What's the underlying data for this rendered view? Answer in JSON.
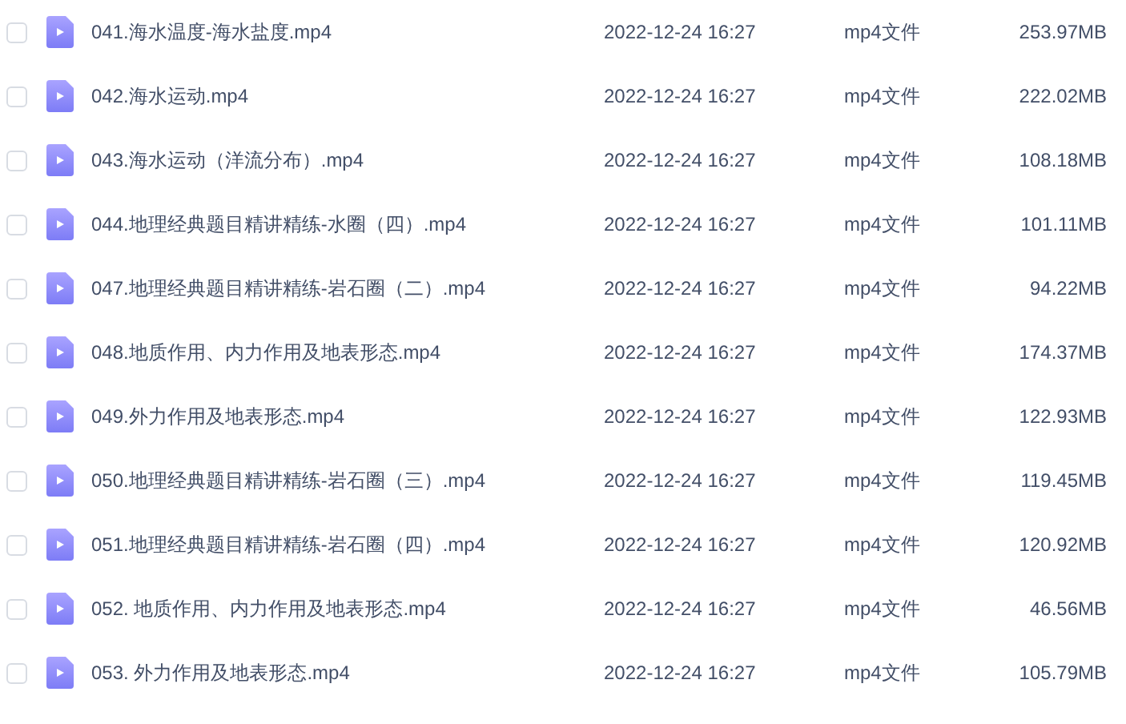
{
  "files": [
    {
      "name": "041.海水温度-海水盐度.mp4",
      "modified": "2022-12-24 16:27",
      "type": "mp4文件",
      "size": "253.97MB",
      "checked": false
    },
    {
      "name": "042.海水运动.mp4",
      "modified": "2022-12-24 16:27",
      "type": "mp4文件",
      "size": "222.02MB",
      "checked": false
    },
    {
      "name": "043.海水运动（洋流分布）.mp4",
      "modified": "2022-12-24 16:27",
      "type": "mp4文件",
      "size": "108.18MB",
      "checked": false
    },
    {
      "name": "044.地理经典题目精讲精练-水圈（四）.mp4",
      "modified": "2022-12-24 16:27",
      "type": "mp4文件",
      "size": "101.11MB",
      "checked": false
    },
    {
      "name": "047.地理经典题目精讲精练-岩石圈（二）.mp4",
      "modified": "2022-12-24 16:27",
      "type": "mp4文件",
      "size": "94.22MB",
      "checked": false
    },
    {
      "name": "048.地质作用、内力作用及地表形态.mp4",
      "modified": "2022-12-24 16:27",
      "type": "mp4文件",
      "size": "174.37MB",
      "checked": false
    },
    {
      "name": "049.外力作用及地表形态.mp4",
      "modified": "2022-12-24 16:27",
      "type": "mp4文件",
      "size": "122.93MB",
      "checked": false
    },
    {
      "name": "050.地理经典题目精讲精练-岩石圈（三）.mp4",
      "modified": "2022-12-24 16:27",
      "type": "mp4文件",
      "size": "119.45MB",
      "checked": false
    },
    {
      "name": "051.地理经典题目精讲精练-岩石圈（四）.mp4",
      "modified": "2022-12-24 16:27",
      "type": "mp4文件",
      "size": "120.92MB",
      "checked": false
    },
    {
      "name": "052. 地质作用、内力作用及地表形态.mp4",
      "modified": "2022-12-24 16:27",
      "type": "mp4文件",
      "size": "46.56MB",
      "checked": false
    },
    {
      "name": "053. 外力作用及地表形态.mp4",
      "modified": "2022-12-24 16:27",
      "type": "mp4文件",
      "size": "105.79MB",
      "checked": false
    }
  ]
}
